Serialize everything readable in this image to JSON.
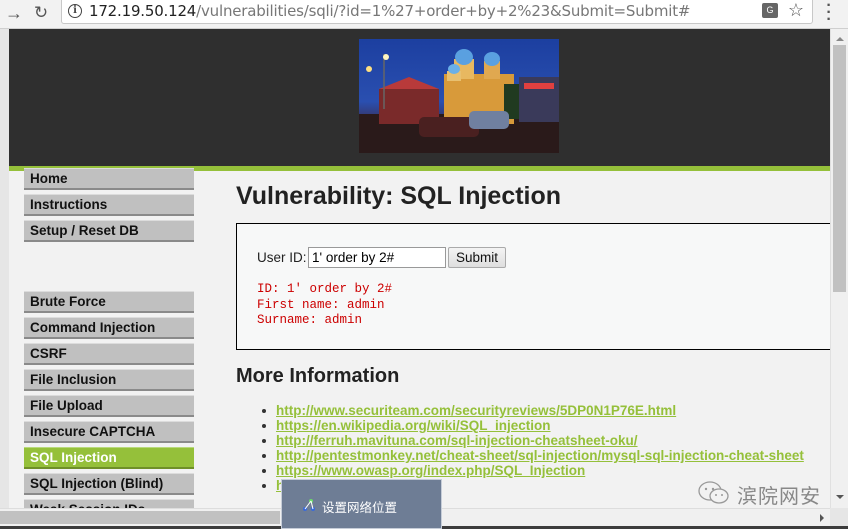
{
  "browser": {
    "url_host": "172.19.50.124",
    "url_path": "/vulnerabilities/sqli/?id=1%27+order+by+2%23&Submit=Submit#",
    "icons": {
      "forward": "forward-arrow-icon",
      "reload": "reload-icon",
      "info": "info-icon",
      "translate": "translate-icon",
      "bookmark": "star-icon",
      "menu": "kebab-menu-icon"
    }
  },
  "header": {
    "banner_image": "night-city-photo",
    "accent_color": "#95c03a"
  },
  "sidebar": {
    "group1": [
      {
        "label": "Home"
      },
      {
        "label": "Instructions"
      },
      {
        "label": "Setup / Reset DB"
      }
    ],
    "group2": [
      {
        "label": "Brute Force"
      },
      {
        "label": "Command Injection"
      },
      {
        "label": "CSRF"
      },
      {
        "label": "File Inclusion"
      },
      {
        "label": "File Upload"
      },
      {
        "label": "Insecure CAPTCHA"
      },
      {
        "label": "SQL Injection",
        "active": true
      },
      {
        "label": "SQL Injection (Blind)"
      },
      {
        "label": "Weak Session IDs"
      }
    ]
  },
  "main": {
    "title": "Vulnerability: SQL Injection",
    "form": {
      "user_id_label": "User ID:",
      "user_id_value": "1' order by 2#",
      "submit_label": "Submit"
    },
    "result": {
      "id_line": "ID: 1' order by 2#",
      "first_name_line": "First name: admin",
      "surname_line": "Surname: admin",
      "color": "#cc0000"
    },
    "more_info_heading": "More Information",
    "links": [
      "http://www.securiteam.com/securityreviews/5DP0N1P76E.html",
      "https://en.wikipedia.org/wiki/SQL_injection",
      "http://ferruh.mavituna.com/sql-injection-cheatsheet-oku/",
      "http://pentestmonkey.net/cheat-sheet/sql-injection/mysql-sql-injection-cheat-sheet",
      "https://www.owasp.org/index.php/SQL_Injection",
      "h"
    ]
  },
  "popup": {
    "label": "设置网络位置",
    "icon": "network-icon"
  },
  "watermark": {
    "text": "滨院网安",
    "icon": "wechat-icon"
  }
}
